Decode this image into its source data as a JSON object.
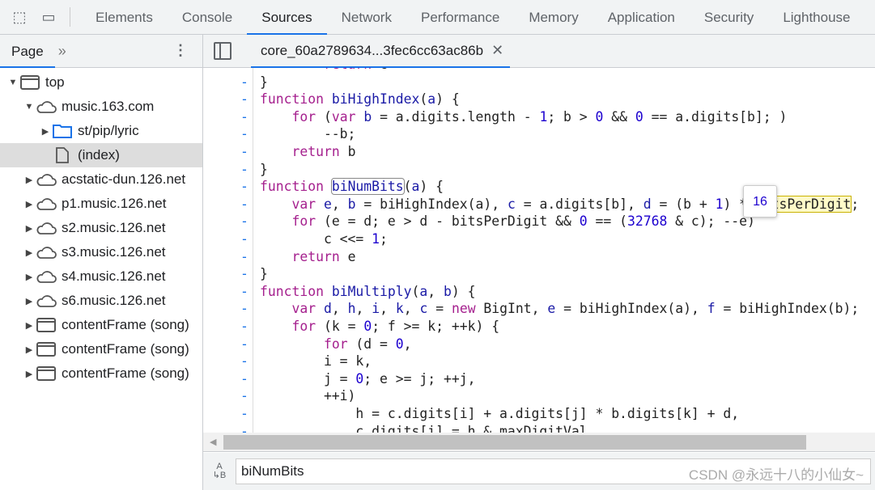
{
  "toolbar": {
    "tabs": [
      "Elements",
      "Console",
      "Sources",
      "Network",
      "Performance",
      "Memory",
      "Application",
      "Security",
      "Lighthouse"
    ],
    "active": "Sources"
  },
  "navigator": {
    "tab": "Page",
    "more": "»",
    "tree": [
      {
        "label": "top",
        "icon": "frame-icon",
        "depth": 0,
        "expanded": true
      },
      {
        "label": "music.163.com",
        "icon": "cloud-icon",
        "depth": 1,
        "expanded": true
      },
      {
        "label": "st/pip/lyric",
        "icon": "folder-icon",
        "depth": 2,
        "expanded": false
      },
      {
        "label": "(index)",
        "icon": "file-icon",
        "depth": 2,
        "selected": true
      },
      {
        "label": "acstatic-dun.126.net",
        "icon": "cloud-icon",
        "depth": 1,
        "expanded": false
      },
      {
        "label": "p1.music.126.net",
        "icon": "cloud-icon",
        "depth": 1,
        "expanded": false
      },
      {
        "label": "s2.music.126.net",
        "icon": "cloud-icon",
        "depth": 1,
        "expanded": false
      },
      {
        "label": "s3.music.126.net",
        "icon": "cloud-icon",
        "depth": 1,
        "expanded": false
      },
      {
        "label": "s4.music.126.net",
        "icon": "cloud-icon",
        "depth": 1,
        "expanded": false
      },
      {
        "label": "s6.music.126.net",
        "icon": "cloud-icon",
        "depth": 1,
        "expanded": false
      },
      {
        "label": "contentFrame (song)",
        "icon": "frame-icon",
        "depth": 1,
        "expanded": false
      },
      {
        "label": "contentFrame (song)",
        "icon": "frame-icon",
        "depth": 1,
        "expanded": false
      },
      {
        "label": "contentFrame (song)",
        "icon": "frame-icon",
        "depth": 1,
        "expanded": false
      }
    ]
  },
  "editor": {
    "file_tab": "core_60a2789634...3fec6cc63ac86b",
    "gutter_mark": "-",
    "lines": [
      [
        [
          "p",
          "        "
        ],
        [
          "k",
          "return"
        ],
        [
          "p",
          " c"
        ]
      ],
      [
        [
          "p",
          "}"
        ]
      ],
      [
        [
          "k",
          "function"
        ],
        [
          "p",
          " "
        ],
        [
          "f",
          "biHighIndex"
        ],
        [
          "p",
          "("
        ],
        [
          "v",
          "a"
        ],
        [
          "p",
          ") {"
        ]
      ],
      [
        [
          "p",
          "    "
        ],
        [
          "k",
          "for"
        ],
        [
          "p",
          " ("
        ],
        [
          "k",
          "var"
        ],
        [
          "p",
          " "
        ],
        [
          "v",
          "b"
        ],
        [
          "p",
          " = a.digits.length - "
        ],
        [
          "n",
          "1"
        ],
        [
          "p",
          "; b > "
        ],
        [
          "n",
          "0"
        ],
        [
          "p",
          " && "
        ],
        [
          "n",
          "0"
        ],
        [
          "p",
          " == a.digits[b]; )"
        ]
      ],
      [
        [
          "p",
          "        --b;"
        ]
      ],
      [
        [
          "p",
          "    "
        ],
        [
          "k",
          "return"
        ],
        [
          "p",
          " b"
        ]
      ],
      [
        [
          "p",
          "}"
        ]
      ],
      [
        [
          "k",
          "function"
        ],
        [
          "p",
          " "
        ],
        [
          "f",
          "biNumBits",
          "box"
        ],
        [
          "p",
          "("
        ],
        [
          "v",
          "a"
        ],
        [
          "p",
          ") {"
        ]
      ],
      [
        [
          "p",
          "    "
        ],
        [
          "k",
          "var"
        ],
        [
          "p",
          " "
        ],
        [
          "v",
          "e"
        ],
        [
          "p",
          ", "
        ],
        [
          "v",
          "b"
        ],
        [
          "p",
          " = biHighIndex(a), "
        ],
        [
          "v",
          "c"
        ],
        [
          "p",
          " = a.digits[b], "
        ],
        [
          "v",
          "d"
        ],
        [
          "p",
          " = (b + "
        ],
        [
          "n",
          "1"
        ],
        [
          "p",
          ") * "
        ],
        [
          "p",
          "bitsPerDigit",
          "yel"
        ],
        [
          "p",
          ";"
        ]
      ],
      [
        [
          "p",
          "    "
        ],
        [
          "k",
          "for"
        ],
        [
          "p",
          " (e = d; e > d - bitsPerDigit && "
        ],
        [
          "n",
          "0"
        ],
        [
          "p",
          " == ("
        ],
        [
          "n",
          "32768"
        ],
        [
          "p",
          " & c); --e)"
        ]
      ],
      [
        [
          "p",
          "        c <<= "
        ],
        [
          "n",
          "1"
        ],
        [
          "p",
          ";"
        ]
      ],
      [
        [
          "p",
          "    "
        ],
        [
          "k",
          "return"
        ],
        [
          "p",
          " e"
        ]
      ],
      [
        [
          "p",
          "}"
        ]
      ],
      [
        [
          "k",
          "function"
        ],
        [
          "p",
          " "
        ],
        [
          "f",
          "biMultiply"
        ],
        [
          "p",
          "("
        ],
        [
          "v",
          "a"
        ],
        [
          "p",
          ", "
        ],
        [
          "v",
          "b"
        ],
        [
          "p",
          ") {"
        ]
      ],
      [
        [
          "p",
          "    "
        ],
        [
          "k",
          "var"
        ],
        [
          "p",
          " "
        ],
        [
          "v",
          "d"
        ],
        [
          "p",
          ", "
        ],
        [
          "v",
          "h"
        ],
        [
          "p",
          ", "
        ],
        [
          "v",
          "i"
        ],
        [
          "p",
          ", "
        ],
        [
          "v",
          "k"
        ],
        [
          "p",
          ", "
        ],
        [
          "v",
          "c"
        ],
        [
          "p",
          " = "
        ],
        [
          "k",
          "new"
        ],
        [
          "p",
          " BigInt, "
        ],
        [
          "v",
          "e"
        ],
        [
          "p",
          " = biHighIndex(a), "
        ],
        [
          "v",
          "f"
        ],
        [
          "p",
          " = biHighIndex(b);"
        ]
      ],
      [
        [
          "p",
          "    "
        ],
        [
          "k",
          "for"
        ],
        [
          "p",
          " (k = "
        ],
        [
          "n",
          "0"
        ],
        [
          "p",
          "; f >= k; ++k) {"
        ]
      ],
      [
        [
          "p",
          "        "
        ],
        [
          "k",
          "for"
        ],
        [
          "p",
          " (d = "
        ],
        [
          "n",
          "0"
        ],
        [
          "p",
          ","
        ]
      ],
      [
        [
          "p",
          "        i = k,"
        ]
      ],
      [
        [
          "p",
          "        j = "
        ],
        [
          "n",
          "0"
        ],
        [
          "p",
          "; e >= j; ++j,"
        ]
      ],
      [
        [
          "p",
          "        ++i)"
        ]
      ],
      [
        [
          "p",
          "            h = c.digits[i] + a.digits[j] * b.digits[k] + d,"
        ]
      ],
      [
        [
          "p",
          "            c.digits[i] = h & maxDigitVal,"
        ]
      ]
    ],
    "tooltip_value": "16"
  },
  "search": {
    "value": "biNumBits",
    "case_icon": "match-case-icon"
  },
  "watermark": "CSDN @永远十八的小仙女~"
}
